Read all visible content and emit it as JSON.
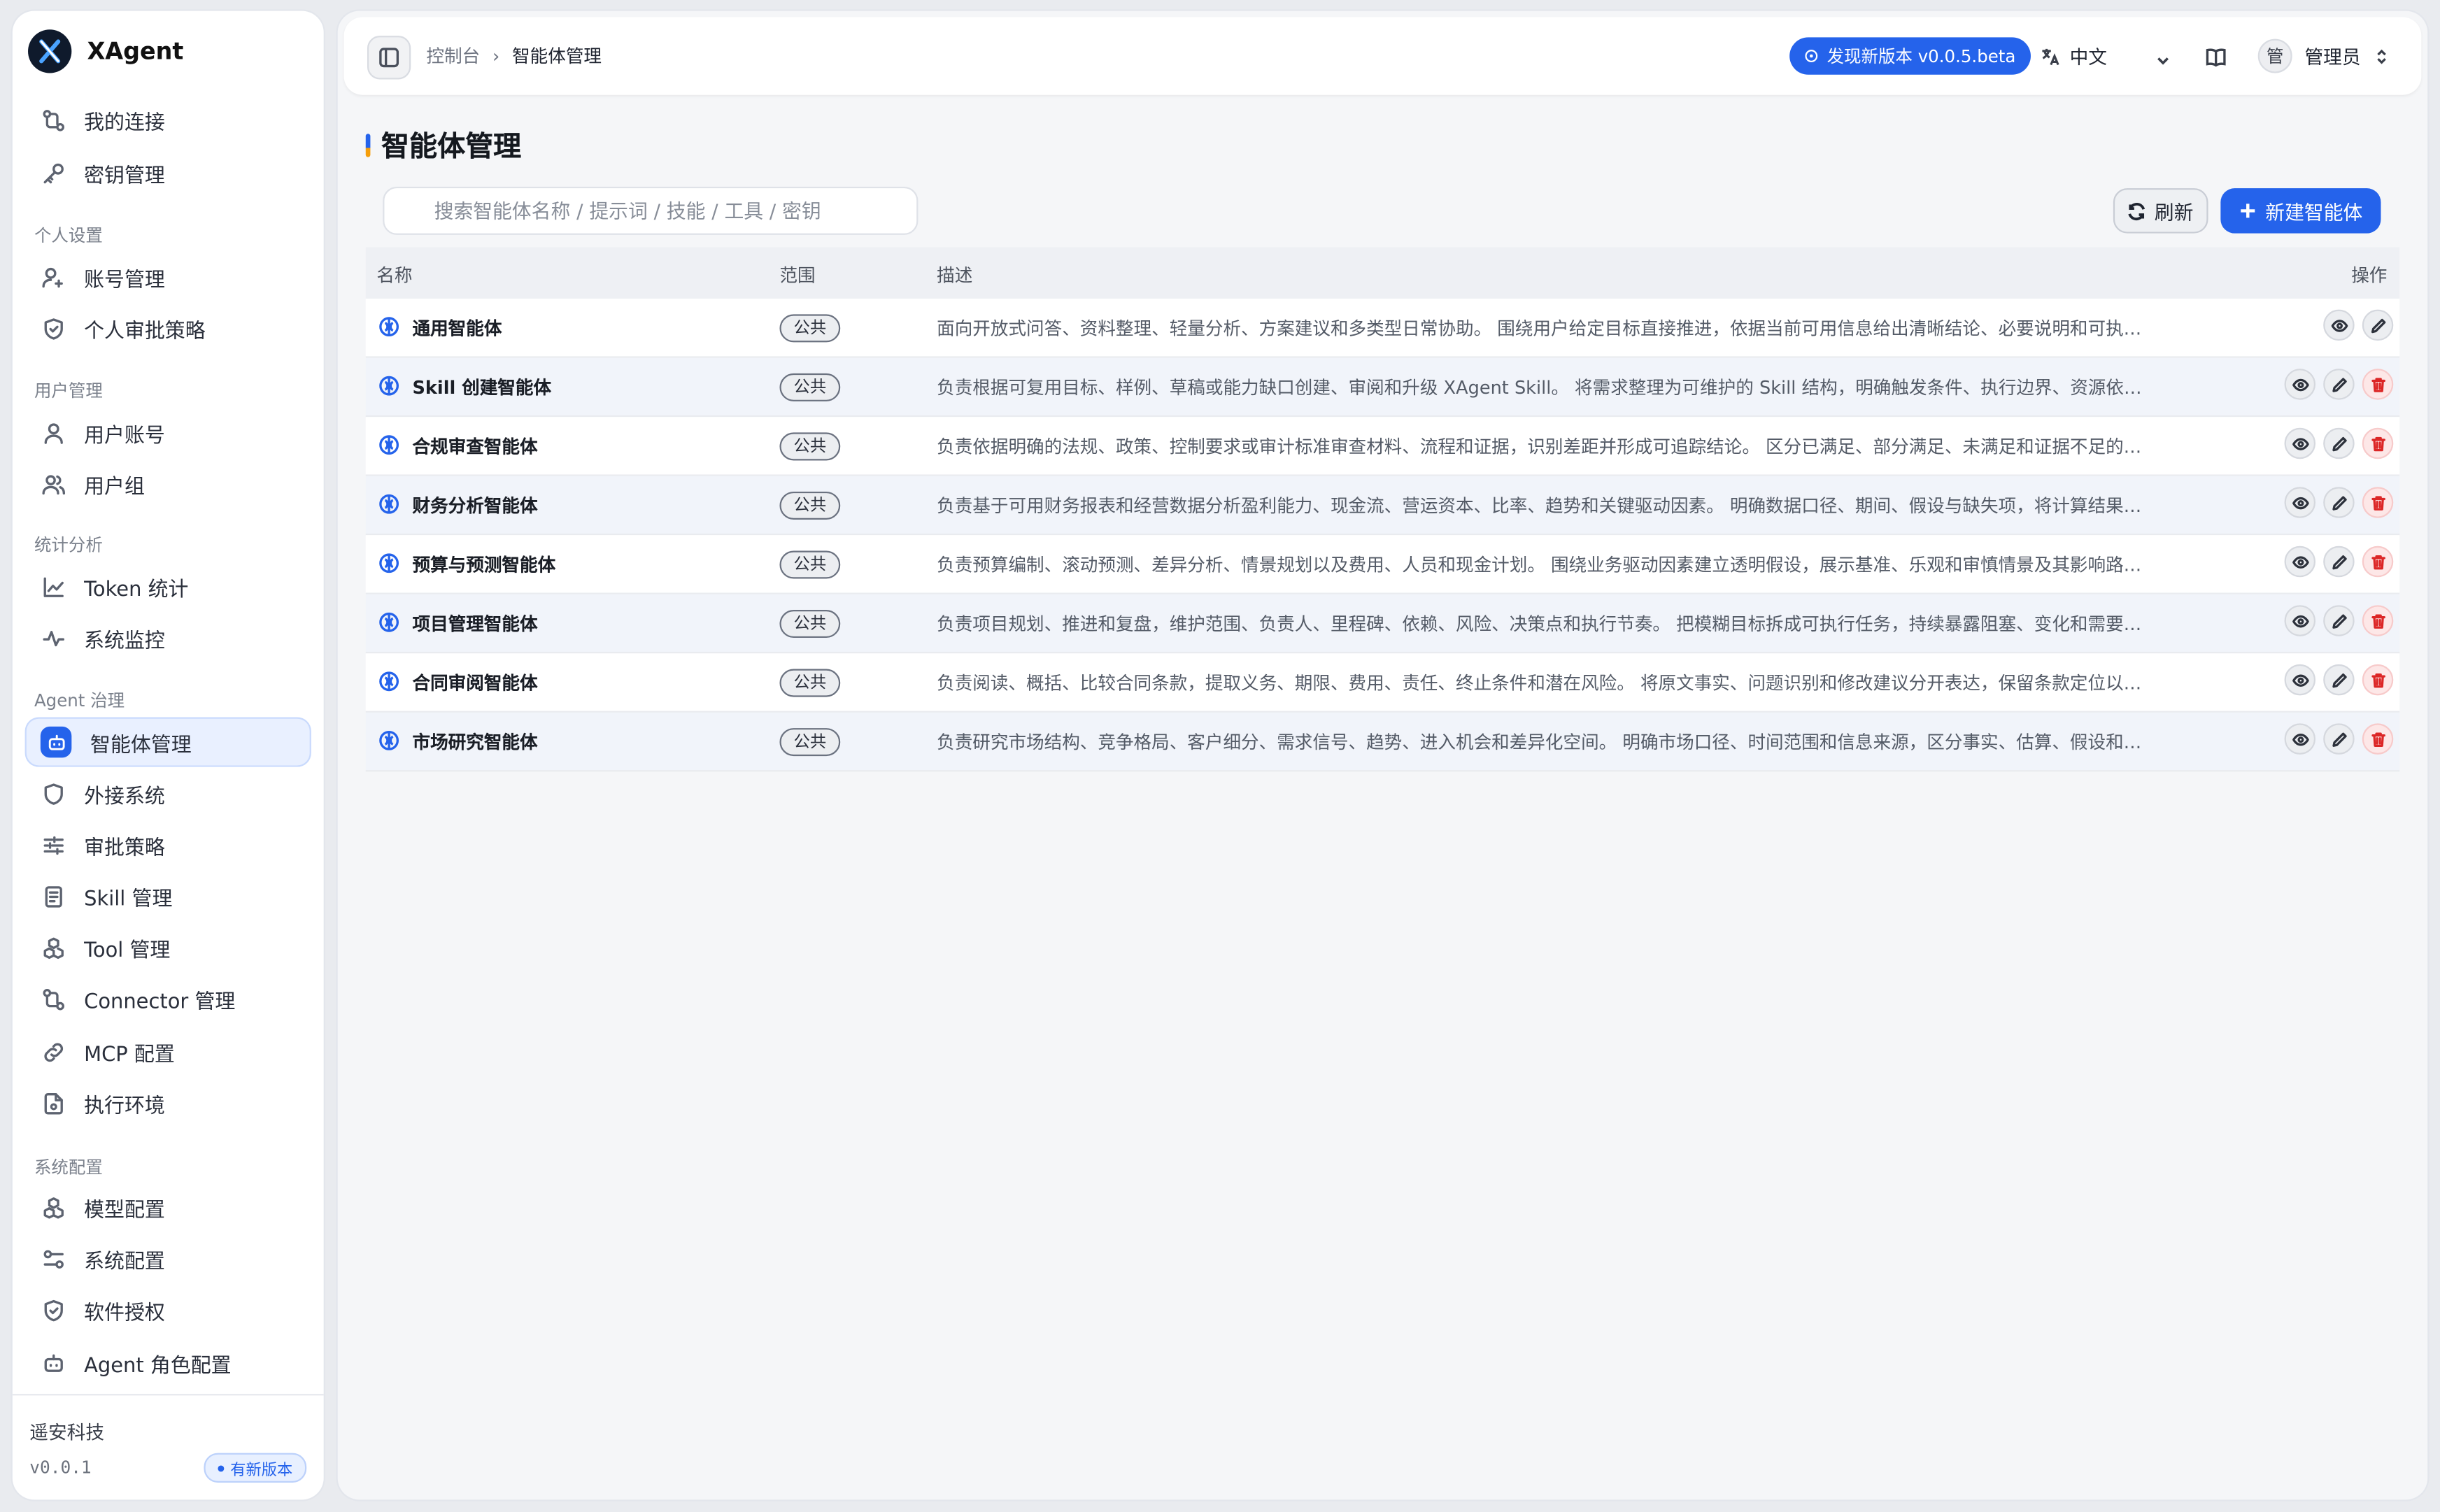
{
  "app": {
    "name": "XAgent"
  },
  "sidebar": {
    "items_top": [
      {
        "label": "我的连接",
        "icon": "connection-icon"
      },
      {
        "label": "密钥管理",
        "icon": "key-icon"
      }
    ],
    "sections": [
      {
        "title": "个人设置",
        "items": [
          {
            "label": "账号管理",
            "icon": "user-settings-icon"
          },
          {
            "label": "个人审批策略",
            "icon": "shield-icon"
          }
        ]
      },
      {
        "title": "用户管理",
        "items": [
          {
            "label": "用户账号",
            "icon": "user-icon"
          },
          {
            "label": "用户组",
            "icon": "users-icon"
          }
        ]
      },
      {
        "title": "统计分析",
        "items": [
          {
            "label": "Token 统计",
            "icon": "chart-line-icon"
          },
          {
            "label": "系统监控",
            "icon": "activity-icon"
          }
        ]
      },
      {
        "title": "Agent 治理",
        "items": [
          {
            "label": "智能体管理",
            "icon": "bot-icon"
          },
          {
            "label": "外接系统",
            "icon": "shield-icon"
          },
          {
            "label": "审批策略",
            "icon": "sliders-icon"
          },
          {
            "label": "Skill 管理",
            "icon": "doc-icon"
          },
          {
            "label": "Tool 管理",
            "icon": "boxes-icon"
          },
          {
            "label": "Connector 管理",
            "icon": "connection-icon"
          },
          {
            "label": "MCP 配置",
            "icon": "link-icon"
          },
          {
            "label": "执行环境",
            "icon": "file-cog-icon"
          }
        ]
      },
      {
        "title": "系统配置",
        "items": [
          {
            "label": "模型配置",
            "icon": "boxes-icon"
          },
          {
            "label": "系统配置",
            "icon": "settings-icon"
          },
          {
            "label": "软件授权",
            "icon": "shield-icon"
          },
          {
            "label": "Agent 角色配置",
            "icon": "bot-icon"
          }
        ]
      }
    ],
    "footer": {
      "company": "遥安科技",
      "version": "v0.0.1",
      "update_badge": "有新版本"
    }
  },
  "topbar": {
    "breadcrumb": [
      "控制台",
      "智能体管理"
    ],
    "new_version": "发现新版本 v0.0.5.beta",
    "language": "中文",
    "user": {
      "avatar_text": "管",
      "name": "管理员"
    }
  },
  "page": {
    "title": "智能体管理",
    "search_placeholder": "搜索智能体名称 / 提示词 / 技能 / 工具 / 密钥",
    "refresh_label": "刷新",
    "new_label": "新建智能体"
  },
  "table": {
    "columns": {
      "name": "名称",
      "scope": "范围",
      "desc": "描述",
      "actions": "操作"
    },
    "rows": [
      {
        "name": "通用智能体",
        "scope": "公共",
        "desc": "面向开放式问答、资料整理、轻量分析、方案建议和多类型日常协助。 围绕用户给定目标直接推进，依据当前可用信息给出清晰结论、必要说明和可执行的下一步建议。",
        "deletable": false
      },
      {
        "name": "Skill 创建智能体",
        "scope": "公共",
        "desc": "负责根据可复用目标、样例、草稿或能力缺口创建、审阅和升级 XAgent Skill。 将需求整理为可维护的 Skill 结构，明确触发条件、执行边界、资源依赖和验证方式。",
        "deletable": true
      },
      {
        "name": "合规审查智能体",
        "scope": "公共",
        "desc": "负责依据明确的法规、政策、控制要求或审计标准审查材料、流程和证据，识别差距并形成可追踪结论。 区分已满足、部分满足、未满足和证据不足的情况。",
        "deletable": true
      },
      {
        "name": "财务分析智能体",
        "scope": "公共",
        "desc": "负责基于可用财务报表和经营数据分析盈利能力、现金流、营运资本、比率、趋势和关键驱动因素。 明确数据口径、期间、假设与缺失项，将计算结果转化为经营洞察。",
        "deletable": true
      },
      {
        "name": "预算与预测智能体",
        "scope": "公共",
        "desc": "负责预算编制、滚动预测、差异分析、情景规划以及费用、人员和现金计划。 围绕业务驱动因素建立透明假设，展示基准、乐观和审慎情景及其影响路径。",
        "deletable": true
      },
      {
        "name": "项目管理智能体",
        "scope": "公共",
        "desc": "负责项目规划、推进和复盘，维护范围、负责人、里程碑、依赖、风险、决策点和执行节奏。 把模糊目标拆成可执行任务，持续暴露阻塞、变化和需要决策的事项。",
        "deletable": true
      },
      {
        "name": "合同审阅智能体",
        "scope": "公共",
        "desc": "负责阅读、概括、比较合同条款，提取义务、期限、费用、责任、终止条件和潜在风险。 将原文事实、问题识别和修改建议分开表达，保留条款定位以便复核。",
        "deletable": true
      },
      {
        "name": "市场研究智能体",
        "scope": "公共",
        "desc": "负责研究市场结构、竞争格局、客户细分、需求信号、趋势、进入机会和差异化空间。 明确市场口径、时间范围和信息来源，区分事实、估算、假设和判断。",
        "deletable": true
      }
    ]
  }
}
